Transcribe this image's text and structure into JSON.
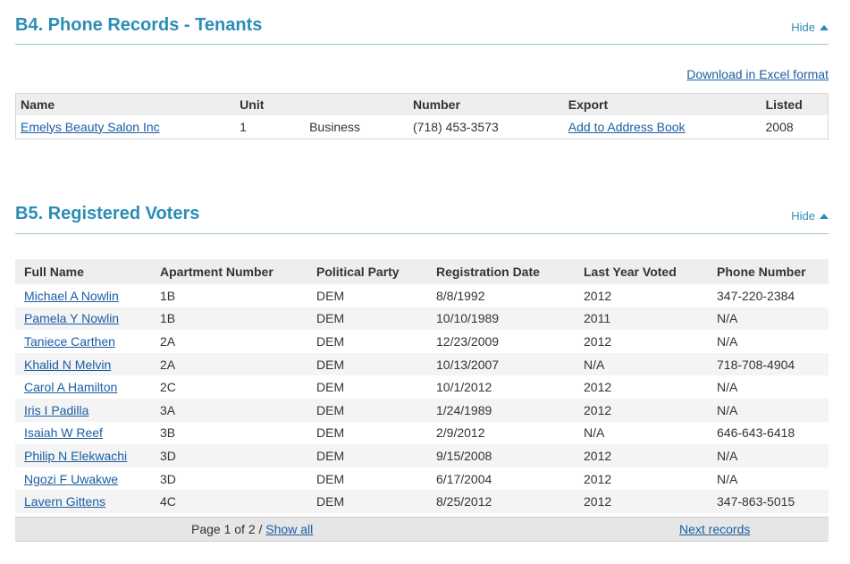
{
  "tenants": {
    "title": "B4. Phone Records - Tenants",
    "hide_label": "Hide",
    "download_label": "Download in Excel format",
    "columns": [
      "Name",
      "Unit",
      "",
      "Number",
      "Export",
      "Listed"
    ],
    "rows": [
      {
        "name": "Emelys Beauty Salon Inc",
        "unit": "1",
        "type": "Business",
        "number": "(718) 453-3573",
        "export": "Add to Address Book",
        "listed": "2008"
      }
    ]
  },
  "voters": {
    "title": "B5. Registered Voters",
    "hide_label": "Hide",
    "columns": [
      "Full Name",
      "Apartment Number",
      "Political Party",
      "Registration Date",
      "Last Year Voted",
      "Phone Number"
    ],
    "rows": [
      {
        "name": "Michael A Nowlin",
        "apt": "1B",
        "party": "DEM",
        "reg": "8/8/1992",
        "last": "2012",
        "phone": "347-220-2384"
      },
      {
        "name": "Pamela Y Nowlin",
        "apt": "1B",
        "party": "DEM",
        "reg": "10/10/1989",
        "last": "2011",
        "phone": "N/A"
      },
      {
        "name": "Taniece Carthen",
        "apt": "2A",
        "party": "DEM",
        "reg": "12/23/2009",
        "last": "2012",
        "phone": "N/A"
      },
      {
        "name": "Khalid N Melvin",
        "apt": "2A",
        "party": "DEM",
        "reg": "10/13/2007",
        "last": "N/A",
        "phone": "718-708-4904"
      },
      {
        "name": "Carol A Hamilton",
        "apt": "2C",
        "party": "DEM",
        "reg": "10/1/2012",
        "last": "2012",
        "phone": "N/A"
      },
      {
        "name": "Iris I Padilla",
        "apt": "3A",
        "party": "DEM",
        "reg": "1/24/1989",
        "last": "2012",
        "phone": "N/A"
      },
      {
        "name": "Isaiah W Reef",
        "apt": "3B",
        "party": "DEM",
        "reg": "2/9/2012",
        "last": "N/A",
        "phone": "646-643-6418"
      },
      {
        "name": "Philip N Elekwachi",
        "apt": "3D",
        "party": "DEM",
        "reg": "9/15/2008",
        "last": "2012",
        "phone": "N/A"
      },
      {
        "name": "Ngozi F Uwakwe",
        "apt": "3D",
        "party": "DEM",
        "reg": "6/17/2004",
        "last": "2012",
        "phone": "N/A"
      },
      {
        "name": "Lavern Gittens",
        "apt": "4C",
        "party": "DEM",
        "reg": "8/25/2012",
        "last": "2012",
        "phone": "347-863-5015"
      }
    ],
    "pager": {
      "text": "Page 1 of 2 / ",
      "show_all": "Show all",
      "next": "Next records"
    }
  }
}
